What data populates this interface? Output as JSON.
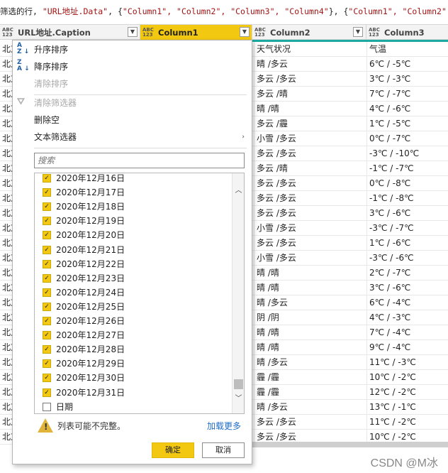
{
  "formula_bar": {
    "prefix": "筛选的行, ",
    "s1": "\"URL地址.Data\"",
    "mid1": ", {",
    "s2": "\"Column1\", \"Column2\", \"Column3\", \"Column4\"",
    "mid2": "}, {",
    "s3": "\"Column1\", \"Column2\", \"C"
  },
  "columns": [
    {
      "type_top": "ABC",
      "type_bottom": "123",
      "label": "URL地址.Caption"
    },
    {
      "type_top": "ABC",
      "type_bottom": "123",
      "label": "Column1"
    },
    {
      "type_top": "ABC",
      "type_bottom": "123",
      "label": "Column2"
    },
    {
      "type_top": "ABC",
      "type_bottom": "123",
      "label": "Column3"
    }
  ],
  "rows": [
    {
      "c0": "北京",
      "c2": "天气状况",
      "c3": "气温"
    },
    {
      "c0": "北京",
      "c2": "晴 /多云",
      "c3": "6℃ / -5℃"
    },
    {
      "c0": "北京",
      "c2": "多云 /多云",
      "c3": "3℃ / -3℃"
    },
    {
      "c0": "北京",
      "c2": "多云 /晴",
      "c3": "7℃ / -7℃"
    },
    {
      "c0": "北京",
      "c2": "晴 /晴",
      "c3": "4℃ / -6℃"
    },
    {
      "c0": "北京",
      "c2": "多云 /霾",
      "c3": "1℃ / -5℃"
    },
    {
      "c0": "北京",
      "c2": "小雪 /多云",
      "c3": "0℃ / -7℃"
    },
    {
      "c0": "北京",
      "c2": "多云 /多云",
      "c3": "-3℃ / -10℃"
    },
    {
      "c0": "北京",
      "c2": "多云 /晴",
      "c3": "-1℃ / -7℃"
    },
    {
      "c0": "北京",
      "c2": "多云 /多云",
      "c3": "0℃ / -8℃"
    },
    {
      "c0": "北京",
      "c2": "多云 /多云",
      "c3": "-1℃ / -8℃"
    },
    {
      "c0": "北京",
      "c2": "多云 /多云",
      "c3": "3℃ / -6℃"
    },
    {
      "c0": "北京",
      "c2": "小雪 /多云",
      "c3": "-3℃ / -7℃"
    },
    {
      "c0": "北京",
      "c2": "多云 /多云",
      "c3": "1℃ / -6℃"
    },
    {
      "c0": "北京",
      "c2": "小雪 /多云",
      "c3": "-3℃ / -6℃"
    },
    {
      "c0": "北京",
      "c2": "晴 /晴",
      "c3": "2℃ / -7℃"
    },
    {
      "c0": "北京",
      "c2": "晴 /晴",
      "c3": "3℃ / -6℃"
    },
    {
      "c0": "北京",
      "c2": "晴 /多云",
      "c3": "6℃ / -4℃"
    },
    {
      "c0": "北京",
      "c2": "阴 /阴",
      "c3": "4℃ / -3℃"
    },
    {
      "c0": "北京",
      "c2": "晴 /晴",
      "c3": "7℃ / -4℃"
    },
    {
      "c0": "北京",
      "c2": "晴 /晴",
      "c3": "9℃ / -4℃"
    },
    {
      "c0": "北京",
      "c2": "晴 /多云",
      "c3": "11℃ / -3℃"
    },
    {
      "c0": "北京",
      "c2": "霾 /霾",
      "c3": "10℃ / -2℃"
    },
    {
      "c0": "北京",
      "c2": "霾 /霾",
      "c3": "12℃ / -2℃"
    },
    {
      "c0": "北京",
      "c2": "晴 /多云",
      "c3": "13℃ / -1℃"
    },
    {
      "c0": "北京",
      "c2": "多云 /多云",
      "c3": "11℃ / -2℃"
    },
    {
      "c0": "北京",
      "c2": "多云 /多云",
      "c3": "10℃ / -2℃"
    }
  ],
  "menu": {
    "sort_asc": "升序排序",
    "sort_desc": "降序排序",
    "clear_sort": "清除排序",
    "clear_filter": "清除筛选器",
    "remove_empty": "删除空",
    "text_filters": "文本筛选器",
    "search_placeholder": "搜索",
    "items": [
      "2020年12月16日",
      "2020年12月17日",
      "2020年12月18日",
      "2020年12月19日",
      "2020年12月20日",
      "2020年12月21日",
      "2020年12月22日",
      "2020年12月23日",
      "2020年12月24日",
      "2020年12月25日",
      "2020年12月26日",
      "2020年12月27日",
      "2020年12月28日",
      "2020年12月29日",
      "2020年12月30日",
      "2020年12月31日",
      "日期"
    ],
    "warning": "列表可能不完整。",
    "load_more": "加载更多",
    "ok": "确定",
    "cancel": "取消"
  },
  "watermark": "CSDN @M冰",
  "colors": {
    "accent": "#f2c811",
    "teal": "#1ca9a0",
    "link": "#1f6cc7"
  }
}
